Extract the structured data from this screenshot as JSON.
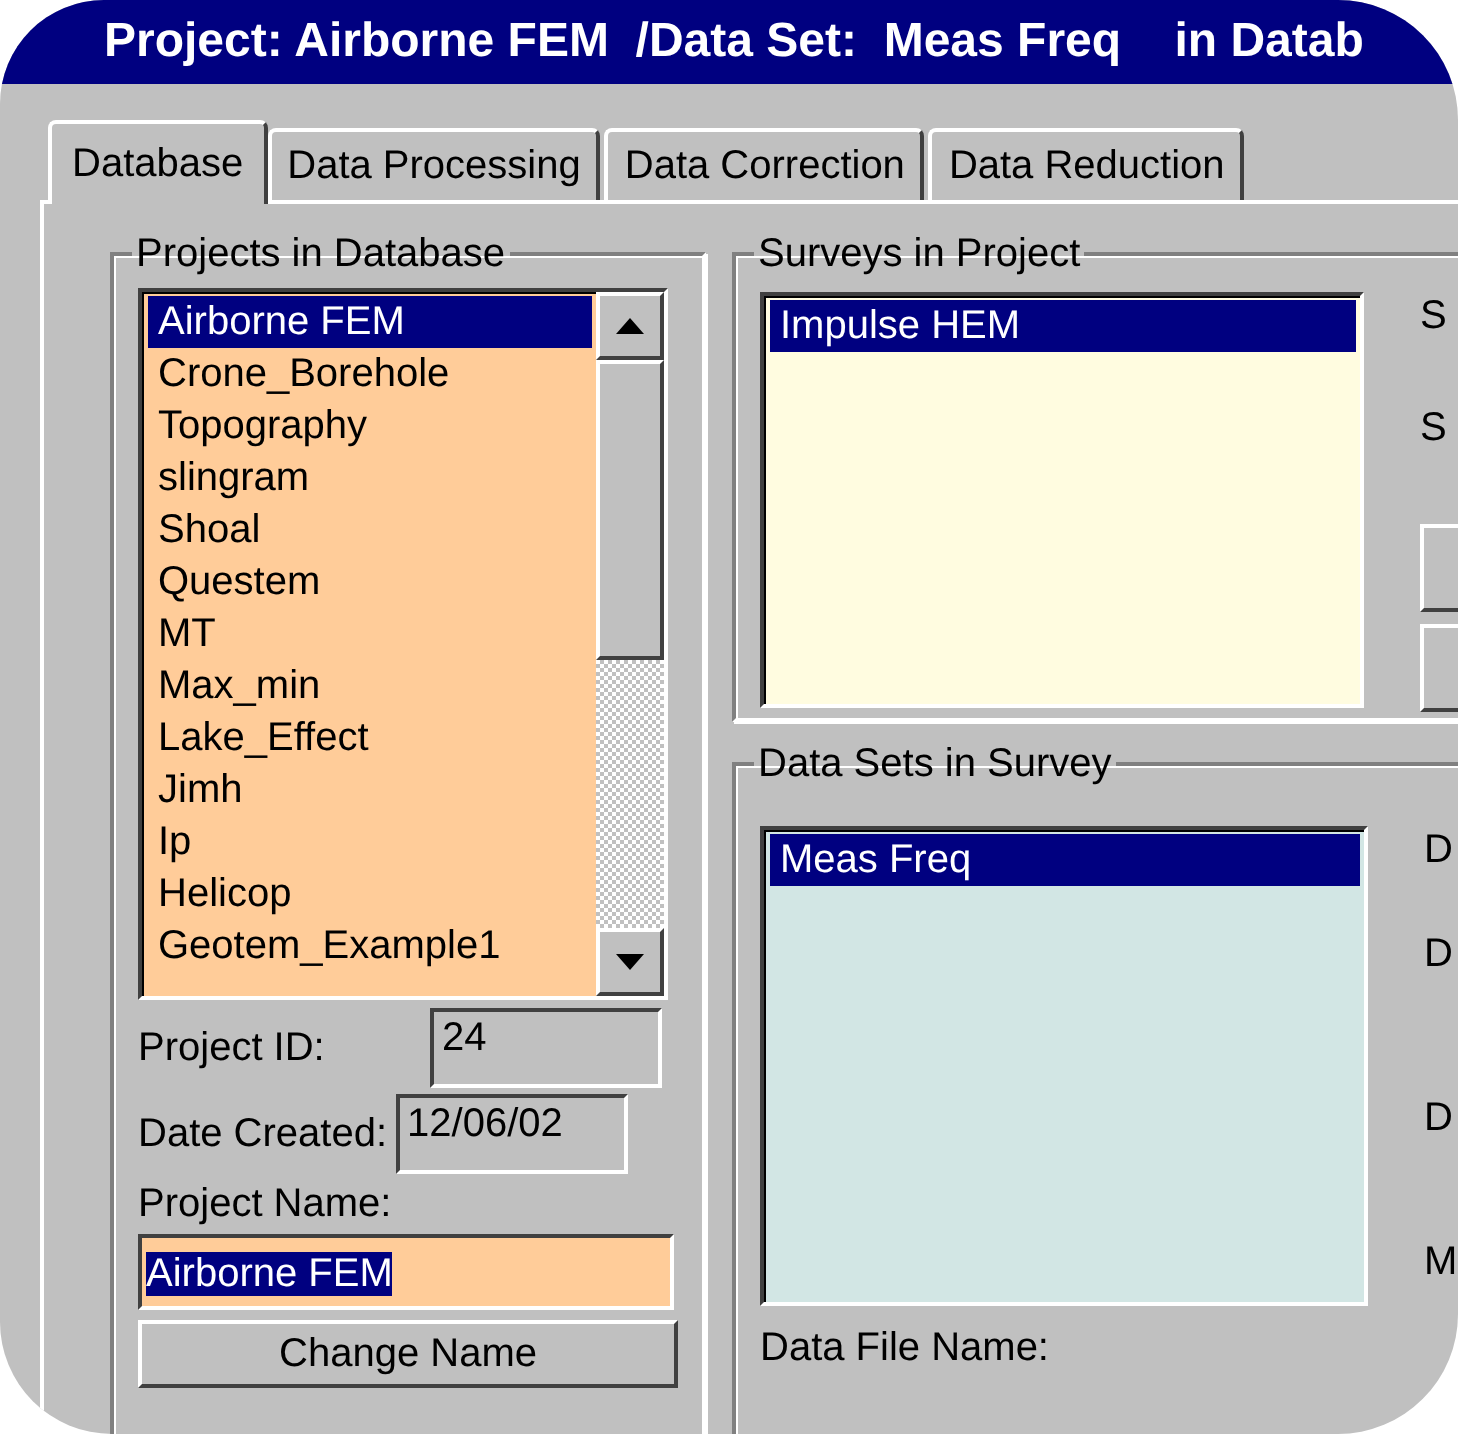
{
  "window": {
    "title": "Project: Airborne FEM  /Data Set:  Meas Freq    in Datab"
  },
  "tabs": [
    {
      "label": "Database",
      "selected": true
    },
    {
      "label": "Data Processing",
      "selected": false
    },
    {
      "label": "Data Correction",
      "selected": false
    },
    {
      "label": "Data Reduction",
      "selected": false
    }
  ],
  "projects": {
    "title": "Projects in Database",
    "items": [
      {
        "label": "Airborne FEM",
        "selected": true
      },
      {
        "label": "Crone_Borehole",
        "selected": false
      },
      {
        "label": "Topography",
        "selected": false
      },
      {
        "label": "slingram",
        "selected": false
      },
      {
        "label": "Shoal",
        "selected": false
      },
      {
        "label": "Questem",
        "selected": false
      },
      {
        "label": "MT",
        "selected": false
      },
      {
        "label": "Max_min",
        "selected": false
      },
      {
        "label": "Lake_Effect",
        "selected": false
      },
      {
        "label": "Jimh",
        "selected": false
      },
      {
        "label": "Ip",
        "selected": false
      },
      {
        "label": "Helicop",
        "selected": false
      },
      {
        "label": "Geotem_Example1",
        "selected": false
      }
    ],
    "project_id": {
      "label": "Project ID:",
      "value": "24"
    },
    "date_created": {
      "label": "Date Created:",
      "value": "12/06/02"
    },
    "project_name": {
      "label": "Project Name:",
      "value": "Airborne FEM",
      "text_selected": true
    },
    "change_name_button": "Change Name"
  },
  "surveys": {
    "title": "Surveys in Project",
    "items": [
      {
        "label": "Impulse HEM",
        "selected": true
      }
    ],
    "side_labels": [
      "S",
      "S"
    ]
  },
  "data_sets": {
    "title": "Data Sets in Survey",
    "items": [
      {
        "label": "Meas Freq",
        "selected": true
      }
    ],
    "side_labels": [
      "D",
      "D",
      "D",
      "M"
    ],
    "file_name_label": "Data File Name:"
  }
}
